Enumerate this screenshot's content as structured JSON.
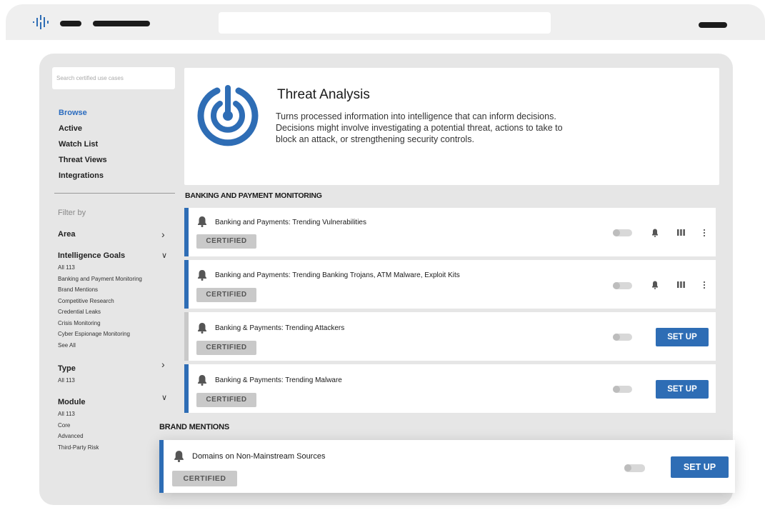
{
  "search": {
    "placeholder": "Search certified use cases"
  },
  "nav": [
    "Browse",
    "Active",
    "Watch List",
    "Threat Views",
    "Integrations"
  ],
  "filters": {
    "label": "Filter by",
    "area": {
      "title": "Area"
    },
    "goals": {
      "title": "Intelligence Goals",
      "options": [
        "All 113",
        "Banking and Payment Monitoring",
        "Brand Mentions",
        "Competitive Research",
        "Credential Leaks",
        "Crisis Monitoring",
        "Cyber Espionage Monitoring",
        "See All"
      ]
    },
    "type": {
      "title": "Type",
      "options": [
        "All 113"
      ]
    },
    "module": {
      "title": "Module",
      "options": [
        "All 113",
        "Core",
        "Advanced",
        "Third-Party Risk"
      ]
    }
  },
  "hero": {
    "title": "Threat Analysis",
    "desc_lines": [
      "Turns processed information into intelligence that can inform decisions.",
      "Decisions might involve investigating a potential threat, actions to take to",
      "block an attack, or strengthening security controls."
    ]
  },
  "sections": [
    {
      "label": "BANKING AND PAYMENT MONITORING",
      "rows": [
        {
          "title": "Banking and Payments: Trending Vulnerabilities",
          "badge": "CERTIFIED",
          "active": true
        },
        {
          "title": "Banking and Payments: Trending Banking Trojans, ATM Malware, Exploit Kits",
          "badge": "CERTIFIED",
          "active": true
        },
        {
          "title": "Banking & Payments: Trending Attackers",
          "badge": "CERTIFIED",
          "action": "SET UP"
        },
        {
          "title": "Banking & Payments: Trending Malware",
          "badge": "CERTIFIED",
          "action": "SET UP"
        }
      ]
    },
    {
      "label": "BRAND MENTIONS",
      "rows": [
        {
          "title": "Domains on Non-Mainstream Sources",
          "badge": "CERTIFIED",
          "action": "SET UP"
        }
      ]
    }
  ],
  "colors": {
    "accent": "#2e6db5",
    "badge": "#c9c9c9",
    "panel": "#e6e6e6"
  }
}
